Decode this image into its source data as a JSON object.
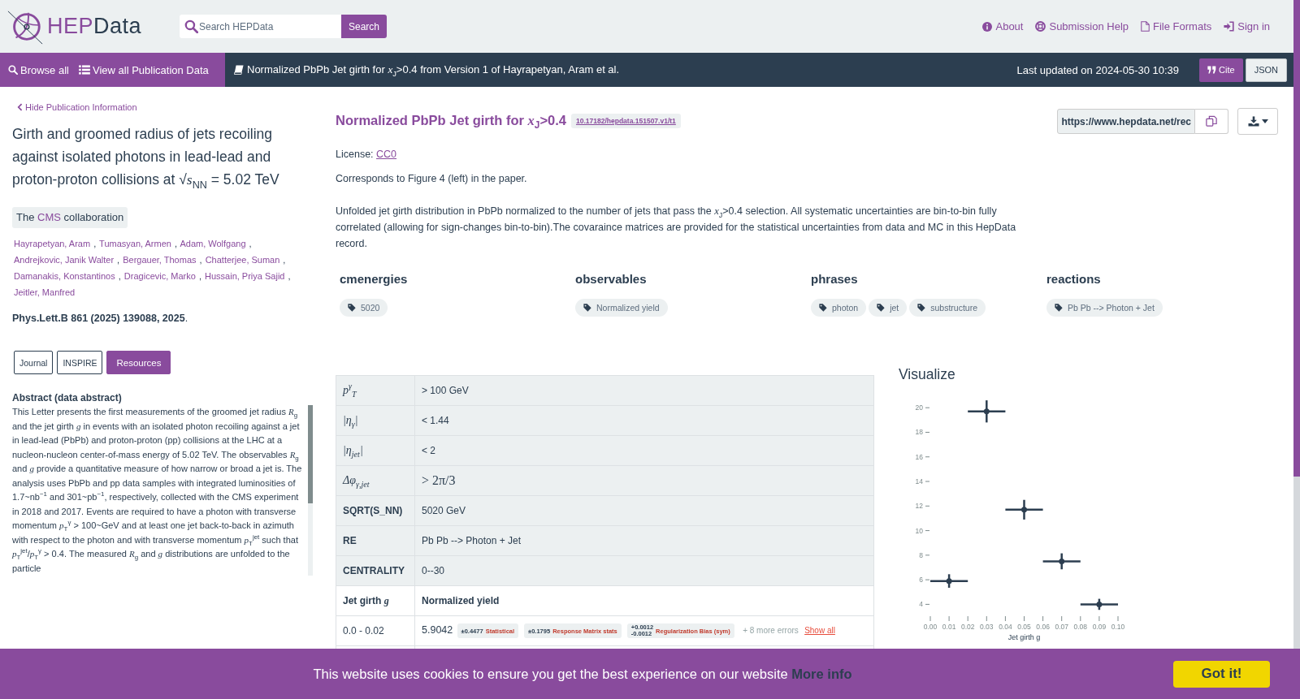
{
  "header": {
    "logo": {
      "accent": "HEP",
      "rest": "Data"
    },
    "search": {
      "placeholder": "Search HEPData",
      "button": "Search"
    },
    "links": [
      "About",
      "Submission Help",
      "File Formats",
      "Sign in"
    ]
  },
  "navbar": {
    "links": [
      "Browse all",
      "View all Publication Data"
    ],
    "title": "Normalized PbPb Jet girth for *x*$_{J}$>0.4 from Version 1 of Hayrapetyan, Aram et al.",
    "last_updated": "Last updated on 2024-05-30 10:39",
    "buttons": [
      {
        "label": "Cite",
        "kind": "primary"
      },
      {
        "label": "JSON",
        "kind": "default"
      }
    ]
  },
  "publication": {
    "hide_link": "Hide Publication Information",
    "title": "Girth and groomed radius of jets recoiling against isolated photons in lead-lead and proton-proton collisions at √*s*$_{NN}$ = 5.02 TeV",
    "collaboration": {
      "before": "The",
      "link": "CMS",
      "after": "collaboration"
    },
    "authors": [
      "Hayrapetyan, Aram",
      "Tumasyan, Armen",
      "Adam, Wolfgang",
      "Andrejkovic, Janik Walter",
      "Bergauer, Thomas",
      "Chatterjee, Suman",
      "Damanakis, Konstantinos",
      "Dragicevic, Marko",
      "Hussain, Priya Sajid",
      "Jeitler, Manfred"
    ],
    "author_separator": ",",
    "journal": "**Phys.Lett.B 861 (2025) 139088, 2025**.",
    "buttons": [
      {
        "label": "Journal",
        "kind": "outline"
      },
      {
        "label": "INSPIRE",
        "kind": "outline"
      },
      {
        "label": "Resources",
        "kind": "primary"
      }
    ],
    "abstract": {
      "heading": "Abstract (data abstract)",
      "text": "This Letter presents the first measurements of the groomed jet radius *R*$_{g}$ and the jet girth *g* in events with an isolated photon recoiling against a jet in lead-lead (PbPb) and proton-proton (pp) collisions at the LHC at a nucleon-nucleon center-of-mass energy of 5.02 TeV. The observables *R*$_{g}$ and *g* provide a quantitative measure of how narrow or broad a jet is. The analysis uses PbPb and pp data samples with integrated luminosities of 1.7~nb$^{−1}$ and 301~pb$^{−1}$, respectively, collected with the CMS experiment in 2018 and 2017. Events are required to have a photon with transverse momentum *p*$_{T}$$^{γ}$ > 100~GeV and at least one jet back-to-back in azimuth with respect to the photon and with transverse momentum *p*$_{T}$$^{jet}$ such that *p*$_{T}$$^{jet}$/*p*$_{T}$$^{γ}$ > 0.4. The measured *R*$_{g}$ and *g* distributions are unfolded to the particle"
    }
  },
  "record": {
    "title": "Normalized PbPb Jet girth for *x*$_{J}$>0.4",
    "doi": "10.17182/hepdata.151507.v1/t1",
    "url": "https://www.hepdata.net/rec",
    "license": {
      "label": "License:",
      "link": "CC0"
    },
    "note": "Corresponds to Figure 4 (left) in the paper.",
    "description": "Unfolded jet girth distribution in PbPb normalized to the number of jets that pass the *x*$_{J}$>0.4 selection. All systematic uncertainties are bin-to-bin fully correlated (allowing for sign-changes bin-to-bin).The covaraince matrices are provided for the statistical uncertainties from data and MC in this HepData record.",
    "keywords": [
      {
        "heading": "cmenergies",
        "tags": [
          "5020"
        ]
      },
      {
        "heading": "observables",
        "tags": [
          "Normalized yield"
        ]
      },
      {
        "heading": "phrases",
        "tags": [
          "photon",
          "jet",
          "substructure"
        ]
      },
      {
        "heading": "reactions",
        "tags": [
          "Pb Pb --> Photon + Jet"
        ]
      }
    ]
  },
  "table": {
    "qualifiers": [
      {
        "name": "p$^{γ}$$_{T}$",
        "kind": "symbol",
        "value": "> 100 GeV"
      },
      {
        "name": "|η$_{γ}$|",
        "kind": "symbol",
        "value": "< 1.44"
      },
      {
        "name": "|η$_{jet}$|",
        "kind": "symbol",
        "value": "< 2"
      },
      {
        "name": "Δφ$_{γ,jet}$",
        "kind": "formula",
        "value": "> 2π/3"
      },
      {
        "name": "SQRT(S_NN)",
        "kind": "label",
        "value": "5020 GeV"
      },
      {
        "name": "RE",
        "kind": "label",
        "value": "Pb Pb --> Photon + Jet"
      },
      {
        "name": "CENTRALITY",
        "kind": "label",
        "value": "0--30"
      }
    ],
    "columns": [
      "Jet girth *g*",
      "Normalized yield"
    ],
    "rows": [
      {
        "x": "0.0 - 0.02",
        "value": "5.9042",
        "errors": [
          {
            "kind": "symmetric",
            "value": "±0.4477",
            "label": "Statistical"
          },
          {
            "kind": "symmetric",
            "value": "±0.1795",
            "label": "Response Matrix stats"
          },
          {
            "kind": "asymmetric",
            "plus": "+0.0012",
            "minus": "-0.0012",
            "label": "Regularization Bias (sym)"
          }
        ],
        "more_errors": "+ 8 more errors",
        "show_all": "Show all"
      }
    ]
  },
  "visualize": {
    "heading": "Visualize",
    "chart_data": {
      "type": "scatter",
      "xlabel": "Jet girth g",
      "x": [
        0.01,
        0.03,
        0.05,
        0.07,
        0.09
      ],
      "series": [
        {
          "color": "#2c3e50",
          "values": [
            5.9,
            19.7,
            11.7,
            7.5,
            4.0
          ],
          "errors": [
            0.55,
            0.9,
            0.8,
            0.65,
            0.45
          ]
        }
      ],
      "xlim": [
        0,
        0.1
      ],
      "ylim": [
        4,
        20
      ],
      "xticks": [
        {
          "value": 0,
          "label": "0.00"
        },
        {
          "value": 0.01,
          "label": "0.01"
        },
        {
          "value": 0.02,
          "label": "0.02"
        },
        {
          "value": 0.03,
          "label": "0.03"
        },
        {
          "value": 0.04,
          "label": "0.04"
        },
        {
          "value": 0.05,
          "label": "0.05"
        },
        {
          "value": 0.06,
          "label": "0.06"
        },
        {
          "value": 0.07,
          "label": "0.07"
        },
        {
          "value": 0.08,
          "label": "0.08"
        },
        {
          "value": 0.09,
          "label": "0.09"
        },
        {
          "value": 0.1,
          "label": "0.10"
        }
      ],
      "yticks": [
        4,
        6,
        8,
        10,
        12,
        14,
        16,
        18,
        20
      ]
    }
  },
  "cookie_banner": {
    "message": "This website uses cookies to ensure you get the best experience on our website",
    "link": "More info",
    "button": "Got it!"
  }
}
